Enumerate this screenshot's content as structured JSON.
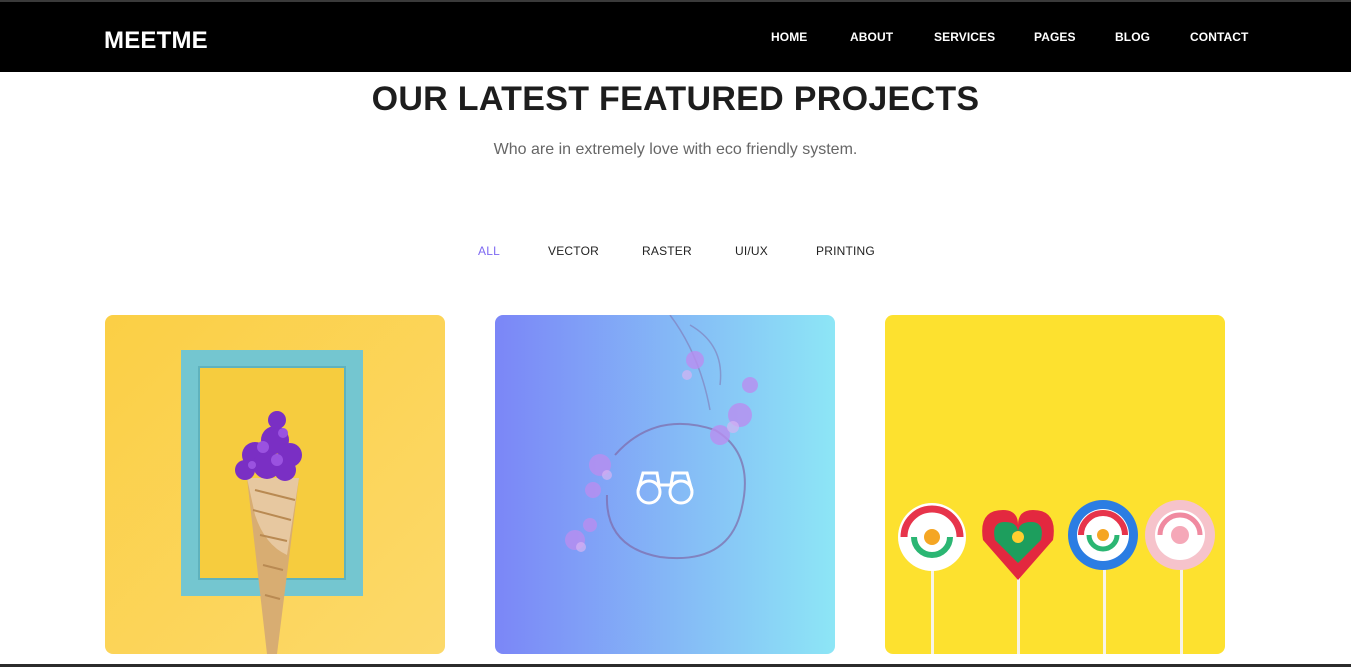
{
  "brand": {
    "logo": "MEETME"
  },
  "nav": {
    "items": [
      {
        "label": "HOME"
      },
      {
        "label": "ABOUT"
      },
      {
        "label": "SERVICES"
      },
      {
        "label": "PAGES"
      },
      {
        "label": "BLOG"
      },
      {
        "label": "CONTACT"
      }
    ]
  },
  "section": {
    "title": "OUR LATEST FEATURED PROJECTS",
    "subtitle": "Who are in extremely love with eco friendly system."
  },
  "filters": {
    "items": [
      {
        "label": "ALL",
        "active": true
      },
      {
        "label": "VECTOR",
        "active": false
      },
      {
        "label": "RASTER",
        "active": false
      },
      {
        "label": "UI/UX",
        "active": false
      },
      {
        "label": "PRINTING",
        "active": false
      }
    ]
  },
  "projects": [
    {
      "image": "flower-ice-cream-cone-in-frame",
      "bg": "#f9d148"
    },
    {
      "image": "floral-wreath-gradient",
      "bg": "#8fc6f6",
      "overlay_icon": "binoculars-icon"
    },
    {
      "image": "lollipops-on-yellow",
      "bg": "#fde232"
    }
  ],
  "colors": {
    "accent": "#7e69f2",
    "nav_bg": "#000000"
  }
}
